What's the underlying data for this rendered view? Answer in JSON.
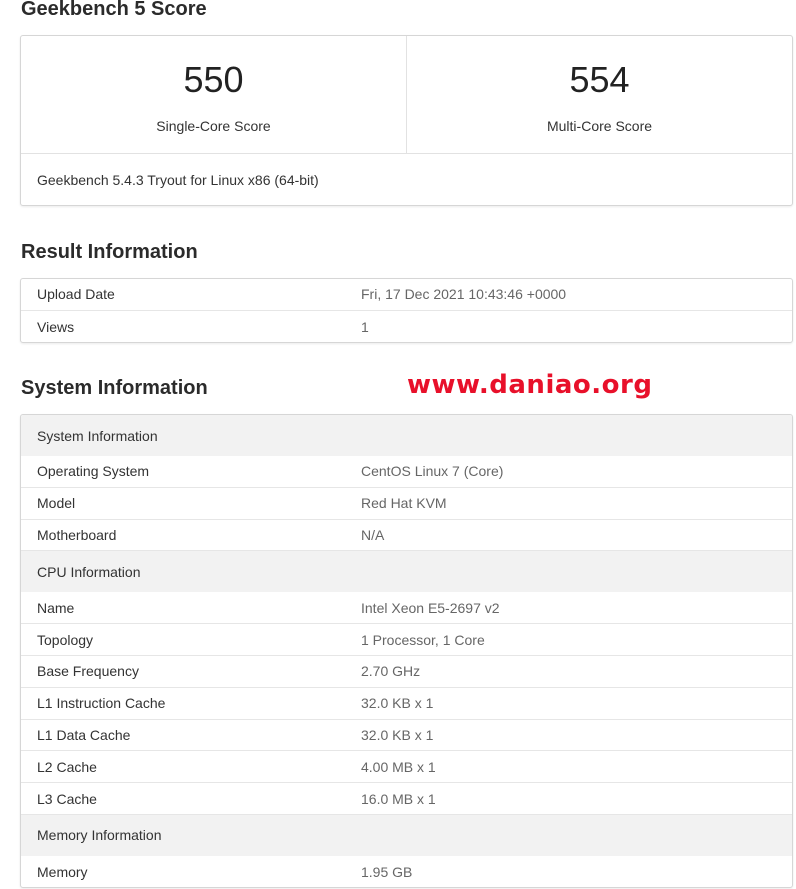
{
  "score_section": {
    "title": "Geekbench 5 Score",
    "single_core": {
      "value": "550",
      "label": "Single-Core Score"
    },
    "multi_core": {
      "value": "554",
      "label": "Multi-Core Score"
    },
    "version": "Geekbench 5.4.3 Tryout for Linux x86 (64-bit)"
  },
  "result_section": {
    "title": "Result Information",
    "rows": [
      {
        "name": "Upload Date",
        "value": "Fri, 17 Dec 2021 10:43:46 +0000"
      },
      {
        "name": "Views",
        "value": "1"
      }
    ]
  },
  "system_section": {
    "title": "System Information",
    "groups": [
      {
        "heading": "System Information",
        "rows": [
          {
            "name": "Operating System",
            "value": "CentOS Linux 7 (Core)"
          },
          {
            "name": "Model",
            "value": "Red Hat KVM"
          },
          {
            "name": "Motherboard",
            "value": "N/A"
          }
        ]
      },
      {
        "heading": "CPU Information",
        "rows": [
          {
            "name": "Name",
            "value": "Intel Xeon E5-2697 v2"
          },
          {
            "name": "Topology",
            "value": "1 Processor, 1 Core"
          },
          {
            "name": "Base Frequency",
            "value": "2.70 GHz"
          },
          {
            "name": "L1 Instruction Cache",
            "value": "32.0 KB x 1"
          },
          {
            "name": "L1 Data Cache",
            "value": "32.0 KB x 1"
          },
          {
            "name": "L2 Cache",
            "value": "4.00 MB x 1"
          },
          {
            "name": "L3 Cache",
            "value": "16.0 MB x 1"
          }
        ]
      },
      {
        "heading": "Memory Information",
        "rows": [
          {
            "name": "Memory",
            "value": "1.95 GB"
          }
        ]
      }
    ]
  },
  "watermark": "www.daniao.org",
  "colors": {
    "watermark": "#e8102a",
    "section_head_bg": "#f2f2f2",
    "border": "#d6d6d6"
  }
}
